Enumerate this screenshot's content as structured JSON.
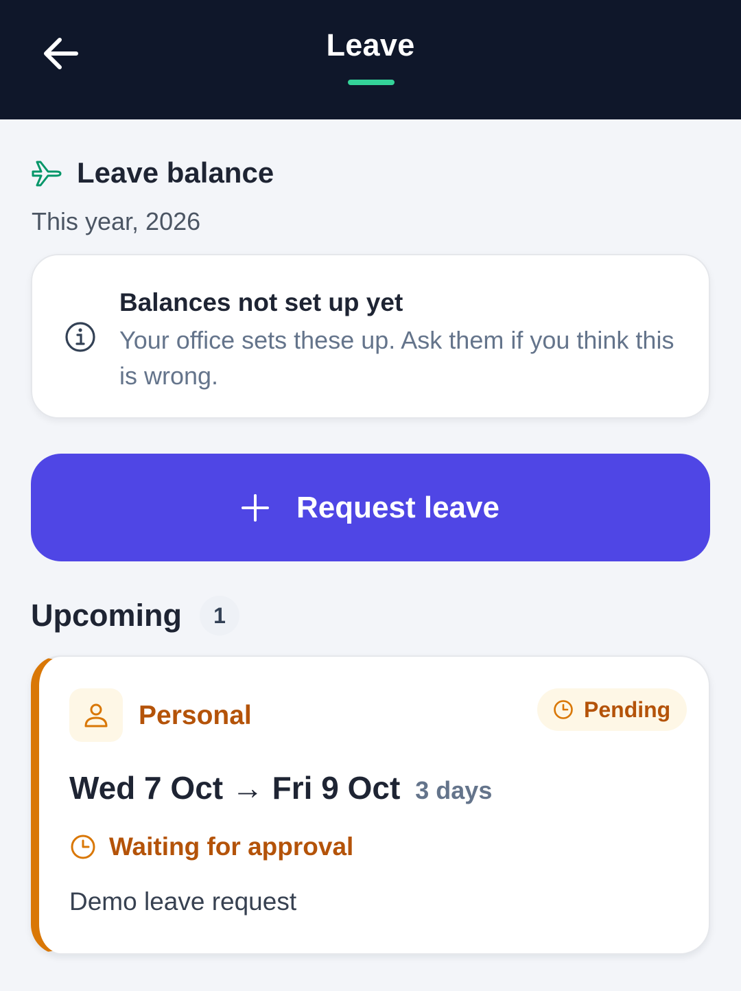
{
  "header": {
    "title": "Leave",
    "back_icon": "arrow-left-icon",
    "accent_color": "#34d399"
  },
  "balance": {
    "icon": "airplane-icon",
    "title": "Leave balance",
    "subtitle": "This year, 2026",
    "notice": {
      "icon": "info-icon",
      "title": "Balances not set up yet",
      "body": "Your office sets these up. Ask them if you think this is wrong."
    }
  },
  "request_button": {
    "icon": "plus-icon",
    "label": "Request leave",
    "color": "#4f46e5"
  },
  "upcoming": {
    "title": "Upcoming",
    "count": "1",
    "items": [
      {
        "type_icon": "person-icon",
        "type": "Personal",
        "status_icon": "clock-icon",
        "status": "Pending",
        "dates": "Wed 7 Oct → Fri 9 Oct",
        "duration": "3 days",
        "approval": "Waiting for approval",
        "note": "Demo leave request",
        "accent_color": "#d97706"
      }
    ]
  }
}
